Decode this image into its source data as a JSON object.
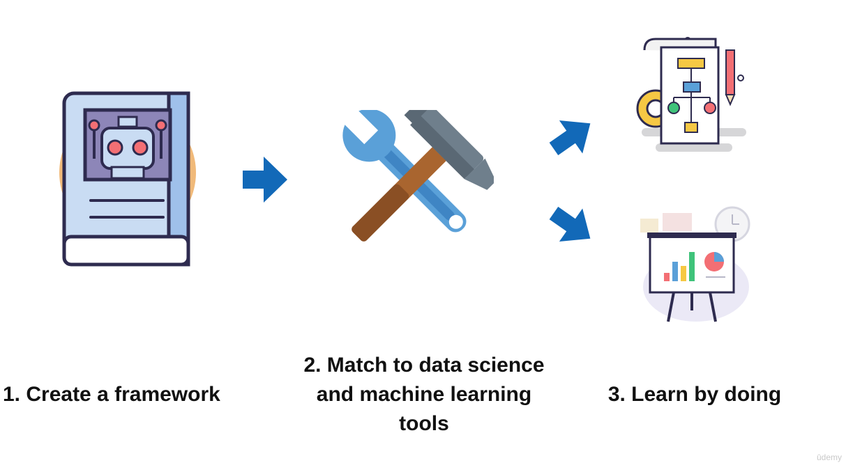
{
  "steps": [
    {
      "label": "1. Create a framework"
    },
    {
      "label_lines": [
        "2. Match to data science",
        "and machine learning",
        "tools"
      ]
    },
    {
      "label": "3. Learn by doing"
    }
  ],
  "icons": [
    "robot-book-icon",
    "hammer-wrench-icon",
    "flowchart-document-icon",
    "presentation-board-icon",
    "arrow-right-icon"
  ],
  "colors": {
    "arrow": "#1269b8",
    "outline": "#2e2b4f",
    "book_blue": "#c9dcf3",
    "robot_red": "#f36f74",
    "accent_yellow": "#f6c844"
  },
  "watermark": "ūdemy"
}
